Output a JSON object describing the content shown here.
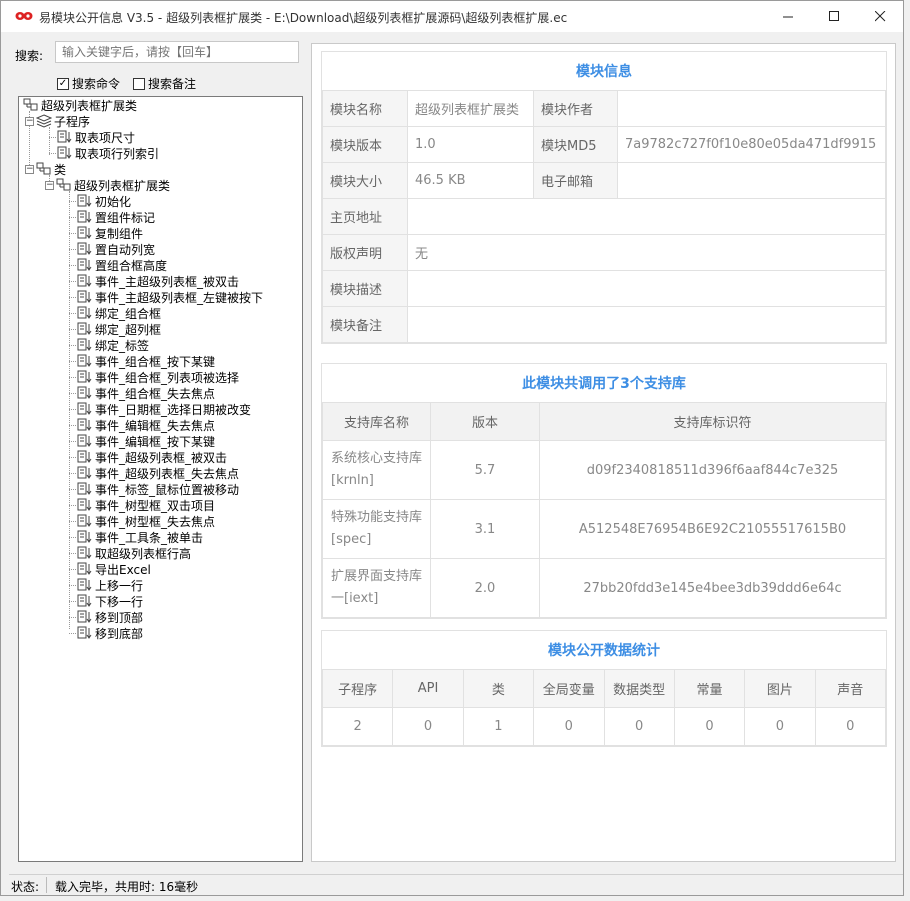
{
  "window": {
    "title": "易模块公开信息 V3.5 - 超级列表框扩展类 - E:\\Download\\超级列表框扩展源码\\超级列表框扩展.ec"
  },
  "search": {
    "label": "搜索:",
    "placeholder": "输入关键字后，请按【回车】",
    "cb_command": "搜索命令",
    "cb_command_checked": true,
    "cb_note": "搜索备注",
    "cb_note_checked": false
  },
  "tree": {
    "root": "超级列表框扩展类",
    "subprog_group": "子程序",
    "subprogs": [
      "取表项尺寸",
      "取表项行列索引"
    ],
    "class_group": "类",
    "class_name": "超级列表框扩展类",
    "methods": [
      "初始化",
      "置组件标记",
      "复制组件",
      "置自动列宽",
      "置组合框高度",
      "事件_主超级列表框_被双击",
      "事件_主超级列表框_左键被按下",
      "绑定_组合框",
      "绑定_超列框",
      "绑定_标签",
      "事件_组合框_按下某键",
      "事件_组合框_列表项被选择",
      "事件_组合框_失去焦点",
      "事件_日期框_选择日期被改变",
      "事件_编辑框_失去焦点",
      "事件_编辑框_按下某键",
      "事件_超级列表框_被双击",
      "事件_超级列表框_失去焦点",
      "事件_标签_鼠标位置被移动",
      "事件_树型框_双击项目",
      "事件_树型框_失去焦点",
      "事件_工具条_被单击",
      "取超级列表框行高",
      "导出Excel",
      "上移一行",
      "下移一行",
      "移到顶部",
      "移到底部"
    ]
  },
  "info": {
    "title": "模块信息",
    "name_label": "模块名称",
    "name_value": "超级列表框扩展类",
    "author_label": "模块作者",
    "author_value": "",
    "version_label": "模块版本",
    "version_value": "1.0",
    "md5_label": "模块MD5",
    "md5_value": "7a9782c727f0f10e80e05da471df9915",
    "size_label": "模块大小",
    "size_value": "46.5 KB",
    "email_label": "电子邮箱",
    "email_value": "",
    "homepage_label": "主页地址",
    "homepage_value": "",
    "copyright_label": "版权声明",
    "copyright_value": "无",
    "desc_label": "模块描述",
    "desc_value": "",
    "note_label": "模块备注",
    "note_value": ""
  },
  "libs": {
    "title": "此模块共调用了3个支持库",
    "headers": [
      "支持库名称",
      "版本",
      "支持库标识符"
    ],
    "rows": [
      {
        "name": "系统核心支持库[krnln]",
        "version": "5.7",
        "id": "d09f2340818511d396f6aaf844c7e325"
      },
      {
        "name": "特殊功能支持库[spec]",
        "version": "3.1",
        "id": "A512548E76954B6E92C21055517615B0"
      },
      {
        "name": "扩展界面支持库一[iext]",
        "version": "2.0",
        "id": "27bb20fdd3e145e4bee3db39ddd6e64c"
      }
    ]
  },
  "stats": {
    "title": "模块公开数据统计",
    "headers": [
      "子程序",
      "API",
      "类",
      "全局变量",
      "数据类型",
      "常量",
      "图片",
      "声音"
    ],
    "values": [
      "2",
      "0",
      "1",
      "0",
      "0",
      "0",
      "0",
      "0"
    ]
  },
  "status": {
    "label": "状态:",
    "text": "载入完毕，共用时: 16毫秒"
  }
}
